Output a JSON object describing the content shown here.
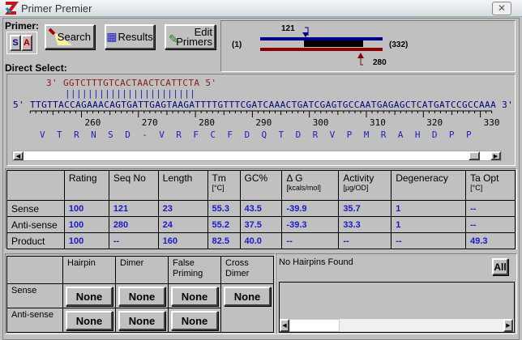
{
  "window": {
    "title": "Primer Premier",
    "close_icon": "close-icon"
  },
  "toolbar": {
    "primer_label": "Primer:",
    "s_label": "S",
    "a_label": "A",
    "search_label": "Search",
    "results_label": "Results",
    "edit_label_1": "Edit",
    "edit_label_2": "Primers",
    "direct_select_label": "Direct Select:"
  },
  "overview": {
    "start": "(1)",
    "end": "(332)",
    "sense_pos": "121",
    "antisense_pos": "280",
    "colors": {
      "sense": "#00008b",
      "antisense": "#8b0000",
      "product": "#000000"
    }
  },
  "sequence": {
    "primer_prefix": "3'",
    "primer": "GGTCTTTGTCACTAACTCATTCTA",
    "primer_suffix": "5'",
    "match_bars": "|||||||||||||||||||||||",
    "prefix": "5'",
    "bases": "TTGTTACCAGAAACAGTGATTGAGTAAGATTTTGTTTCGATCAAACTGATCGAGTGCCAATGAGAGCTCATGATCCGCCAAA",
    "suffix": "3'",
    "ruler_labels": [
      "260",
      "270",
      "280",
      "290",
      "300",
      "310",
      "320",
      "330"
    ],
    "translation": "V  T  R  N  S  D  -  V  R  F  C  F  D  Q  T  D  R  V  P  M  R  A  H  D  P  P"
  },
  "results": {
    "headers": [
      {
        "t": "",
        "s": ""
      },
      {
        "t": "Rating",
        "s": ""
      },
      {
        "t": "Seq No",
        "s": ""
      },
      {
        "t": "Length",
        "s": ""
      },
      {
        "t": "Tm",
        "s": "[°C]"
      },
      {
        "t": "GC%",
        "s": ""
      },
      {
        "t": "Δ G",
        "s": "[kcals/mol]"
      },
      {
        "t": "Activity",
        "s": "[µg/OD]"
      },
      {
        "t": "Degeneracy",
        "s": ""
      },
      {
        "t": "Ta Opt",
        "s": "[°C]"
      }
    ],
    "rows": [
      {
        "label": "Sense",
        "values": [
          "100",
          "121",
          "23",
          "55.3",
          "43.5",
          "-39.9",
          "35.7",
          "1",
          "--"
        ]
      },
      {
        "label": "Anti-sense",
        "values": [
          "100",
          "280",
          "24",
          "55.2",
          "37.5",
          "-39.3",
          "33.3",
          "1",
          "--"
        ]
      },
      {
        "label": "Product",
        "values": [
          "100",
          "--",
          "160",
          "82.5",
          "40.0",
          "--",
          "--",
          "--",
          "49.3"
        ]
      }
    ]
  },
  "analysis": {
    "headers": [
      "Hairpin",
      "Dimer",
      "False Priming",
      "Cross Dimer"
    ],
    "sense_label": "Sense",
    "antisense_label": "Anti-sense",
    "sense": [
      "None",
      "None",
      "None",
      "None"
    ],
    "antisense": [
      "None",
      "None",
      "None"
    ],
    "message": "No Hairpins Found",
    "all_label": "All"
  }
}
